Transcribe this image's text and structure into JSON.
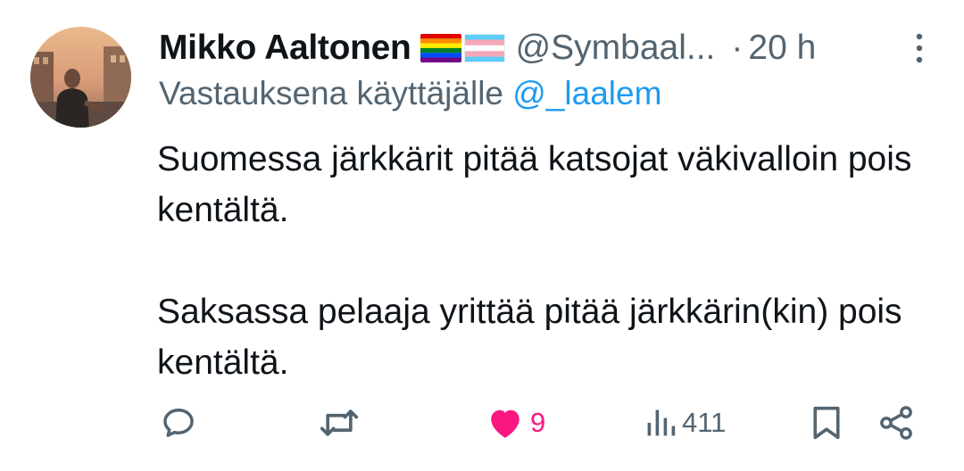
{
  "tweet": {
    "author_name": "Mikko Aaltonen",
    "author_flags": [
      "rainbow-flag-icon",
      "transgender-flag-icon"
    ],
    "handle": "@Symbaal...",
    "dot": "·",
    "time": "20 h",
    "replying_prefix": "Vastauksena käyttäjälle",
    "replying_to": "@_laalem",
    "text_paragraphs": [
      "Suomessa järkkärit pitää katsojat väkivalloin pois kentältä.",
      "Saksassa pelaaja yrittää pitää järkkärin(kin) pois kentältä."
    ]
  },
  "actions": {
    "reply": {
      "icon": "reply-icon"
    },
    "retweet": {
      "icon": "retweet-icon"
    },
    "like": {
      "icon": "heart-icon",
      "count": "9",
      "liked": true,
      "color": "#f91880"
    },
    "views": {
      "icon": "views-icon",
      "count": "411"
    },
    "bookmark": {
      "icon": "bookmark-icon"
    },
    "share": {
      "icon": "share-icon"
    }
  },
  "colors": {
    "text": "#0f1419",
    "secondary": "#536471",
    "mention": "#1d9bf0",
    "like": "#f91880"
  }
}
